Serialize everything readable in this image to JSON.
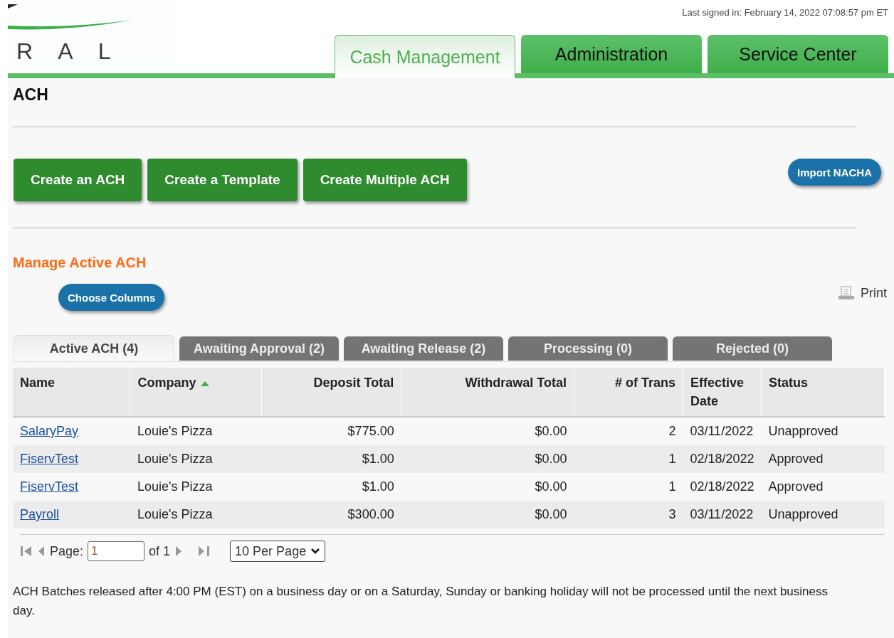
{
  "header": {
    "logo_text": "R A L",
    "last_signed_in": "Last signed in: February 14, 2022 07:08:57 pm ET"
  },
  "nav_tabs": [
    {
      "label": "Cash Management",
      "selected": true
    },
    {
      "label": "Administration",
      "selected": false
    },
    {
      "label": "Service Center",
      "selected": false
    }
  ],
  "page_title": "ACH",
  "actions": [
    "Create an ACH",
    "Create a Template",
    "Create Multiple ACH"
  ],
  "import_button": "Import NACHA",
  "section_title": "Manage Active ACH",
  "choose_columns": "Choose Columns",
  "print": "Print",
  "status_tabs": [
    {
      "label": "Active ACH (4)",
      "selected": true
    },
    {
      "label": "Awaiting Approval (2)",
      "selected": false
    },
    {
      "label": "Awaiting Release (2)",
      "selected": false
    },
    {
      "label": "Processing (0)",
      "selected": false
    },
    {
      "label": "Rejected (0)",
      "selected": false
    }
  ],
  "table": {
    "columns": [
      {
        "label": "Name",
        "numeric": false,
        "sorted": false
      },
      {
        "label": "Company",
        "numeric": false,
        "sorted": true
      },
      {
        "label": "Deposit Total",
        "numeric": true,
        "sorted": false
      },
      {
        "label": "Withdrawal Total",
        "numeric": true,
        "sorted": false
      },
      {
        "label": "# of Trans",
        "numeric": true,
        "sorted": false
      },
      {
        "label": "Effective Date",
        "numeric": false,
        "sorted": false
      },
      {
        "label": "Status",
        "numeric": false,
        "sorted": false
      }
    ],
    "rows": [
      [
        "SalaryPay",
        "Louie's Pizza",
        "$775.00",
        "$0.00",
        "2",
        "03/11/2022",
        "Unapproved"
      ],
      [
        "FiservTest",
        "Louie's Pizza",
        "$1.00",
        "$0.00",
        "1",
        "02/18/2022",
        "Approved"
      ],
      [
        "FiservTest",
        "Louie's Pizza",
        "$1.00",
        "$0.00",
        "1",
        "02/18/2022",
        "Approved"
      ],
      [
        "Payroll",
        "Louie's Pizza",
        "$300.00",
        "$0.00",
        "3",
        "03/11/2022",
        "Unapproved"
      ]
    ]
  },
  "pager": {
    "page_label": "Page:",
    "page_value": "1",
    "of_label": "of 1",
    "per_page": "10 Per Page"
  },
  "note": "ACH Batches released after 4:00 PM (EST) on a business day or on a Saturday, Sunday or banking holiday will not be processed until the next business day."
}
